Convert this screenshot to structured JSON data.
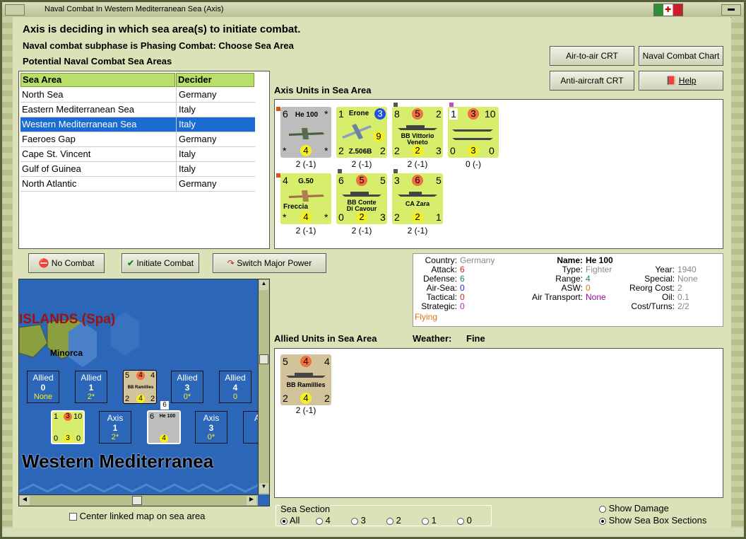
{
  "window": {
    "title": "Naval Combat In Western Mediterranean Sea (Axis)"
  },
  "headings": {
    "line1": "Axis is deciding in which sea area(s) to initiate combat.",
    "line2": "Naval combat subphase is Phasing Combat: Choose Sea Area",
    "line3": "Potential Naval Combat Sea Areas"
  },
  "buttons": {
    "air_to_air": "Air-to-air CRT",
    "naval_chart": "Naval Combat Chart",
    "anti_aircraft": "Anti-aircraft CRT",
    "help": "Help",
    "no_combat": "No Combat",
    "initiate_combat": "Initiate Combat",
    "switch_major": "Switch Major Power"
  },
  "table": {
    "headers": [
      "Sea Area",
      "Decider"
    ],
    "rows": [
      [
        "North Sea",
        "Germany"
      ],
      [
        "Eastern Mediterranean Sea",
        "Italy"
      ],
      [
        "Western Mediterranean Sea",
        "Italy"
      ],
      [
        "Faeroes Gap",
        "Germany"
      ],
      [
        "Cape St. Vincent",
        "Italy"
      ],
      [
        "Gulf of Guinea",
        "Italy"
      ],
      [
        "North Atlantic",
        "Germany"
      ]
    ],
    "selected_index": 2
  },
  "axis_units": {
    "label": "Axis Units in Sea Area",
    "units": [
      {
        "name": "He 100",
        "tl": "6",
        "tr": "*",
        "bl": "*",
        "bm": "4",
        "br": "*",
        "caption": "2 (-1)"
      },
      {
        "name": "Erone",
        "name2": "Z.506B",
        "tl": "1",
        "tr": "3",
        "mr": "9",
        "bl": "2",
        "br": "2",
        "caption": "2 (-1)"
      },
      {
        "name": "BB Vittorio",
        "name2": "Veneto",
        "tl": "8",
        "tm": "5",
        "tr": "2",
        "bl": "2",
        "bm": "2",
        "br": "3",
        "caption": "2 (-1)"
      },
      {
        "tl": "1",
        "tm": "3",
        "tr": "10",
        "bl": "0",
        "bm": "3",
        "br": "0",
        "caption": "0 (-)"
      },
      {
        "name": "G.50",
        "name2": "Freccia",
        "tl": "4",
        "bl": "*",
        "bm": "4",
        "br": "*",
        "caption": "2 (-1)"
      },
      {
        "name": "BB Conte",
        "name2": "Di Cavour",
        "tl": "6",
        "tm": "5",
        "tr": "5",
        "bl": "0",
        "bm": "2",
        "br": "3",
        "caption": "2 (-1)"
      },
      {
        "name": "CA Zara",
        "tl": "3",
        "tm": "6",
        "tr": "5",
        "bl": "2",
        "bm": "2",
        "br": "1",
        "caption": "2 (-1)"
      }
    ]
  },
  "info": {
    "country_label": "Country:",
    "country": "Germany",
    "attack_label": "Attack:",
    "attack": "6",
    "defense_label": "Defense:",
    "defense": "6",
    "airsea_label": "Air-Sea:",
    "airsea": "0",
    "tactical_label": "Tactical:",
    "tactical": "0",
    "strategic_label": "Strategic:",
    "strategic": "0",
    "status": "Flying",
    "name_label": "Name:",
    "name": "He 100",
    "type_label": "Type:",
    "type": "Fighter",
    "range_label": "Range:",
    "range": "4",
    "asw_label": "ASW:",
    "asw": "0",
    "airtransport_label": "Air Transport:",
    "airtransport": "None",
    "year_label": "Year:",
    "year": "1940",
    "special_label": "Special:",
    "special": "None",
    "reorg_label": "Reorg Cost:",
    "reorg": "2",
    "oil_label": "Oil:",
    "oil": "0.1",
    "costturns_label": "Cost/Turns:",
    "costturns": "2/2"
  },
  "allied_units": {
    "label": "Allied Units in Sea Area",
    "weather_label": "Weather:",
    "weather": "Fine",
    "units": [
      {
        "name": "BB Ramillies",
        "tl": "5",
        "tm": "4",
        "tr": "4",
        "bl": "2",
        "bm": "4",
        "br": "2",
        "caption": "2 (-1)"
      }
    ]
  },
  "map": {
    "region": "ISLANDS (Spa)",
    "island": "Minorca",
    "sea": "Western Mediterranea",
    "allied_boxes": [
      {
        "title": "Allied",
        "num": "0",
        "sub": "None"
      },
      {
        "title": "Allied",
        "num": "1",
        "sub": "2*"
      },
      {
        "title": "Allied",
        "num": "3",
        "sub": "0*"
      },
      {
        "title": "Allied",
        "num": "4",
        "sub": "0"
      }
    ],
    "axis_boxes": [
      {
        "title": "Axis",
        "num": "1",
        "sub": "2*"
      },
      {
        "title": "Axis",
        "num": "3",
        "sub": "0*"
      },
      {
        "title": "Ax"
      }
    ],
    "ramillies": {
      "name": "BB Ramillies",
      "tl": "5",
      "tm": "4",
      "tr": "4",
      "bl": "2",
      "bm": "4",
      "br": "2"
    },
    "stack_a": {
      "tl": "1",
      "tm": "3",
      "tr": "10",
      "bl": "0",
      "bm": "3",
      "br": "0"
    },
    "stack_b": {
      "name": "He 100",
      "tl": "6",
      "bm": "4",
      "badge": "6"
    }
  },
  "footer": {
    "center_map": "Center linked map on sea area",
    "sea_section_label": "Sea Section",
    "sections": [
      "All",
      "4",
      "3",
      "2",
      "1",
      "0"
    ],
    "show_damage": "Show Damage",
    "show_sections": "Show Sea Box Sections"
  },
  "colors": {
    "selected_row": "#1c6bd0",
    "header_green": "#b7df6a",
    "counter_green": "#d6ee6c",
    "sea_blue": "#2c66b8"
  }
}
